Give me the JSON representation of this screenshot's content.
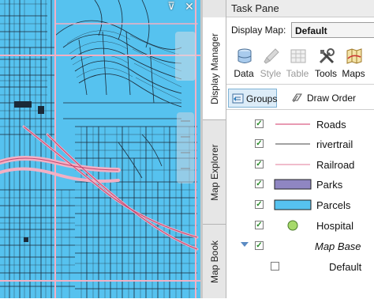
{
  "map_controls": {
    "pin_glyph": "⊽",
    "close_glyph": "✕"
  },
  "side_tabs": [
    "Display Manager",
    "Map Explorer",
    "Map Book"
  ],
  "task_pane": {
    "title": "Task Pane",
    "display_map_label": "Display Map:",
    "display_map_value": "Default",
    "tools": [
      {
        "label": "Data",
        "icon": "database-icon",
        "enabled": true
      },
      {
        "label": "Style",
        "icon": "brush-icon",
        "enabled": false
      },
      {
        "label": "Table",
        "icon": "table-icon",
        "enabled": false
      },
      {
        "label": "Tools",
        "icon": "tools-icon",
        "enabled": true
      },
      {
        "label": "Maps",
        "icon": "maps-icon",
        "enabled": true
      }
    ],
    "groups_label": "Groups",
    "draw_order_label": "Draw Order"
  },
  "layers": [
    {
      "name": "Roads",
      "checked": true,
      "style": "line",
      "color": "#e07a9a"
    },
    {
      "name": "rivertrail",
      "checked": true,
      "style": "line",
      "color": "#333333"
    },
    {
      "name": "Railroad",
      "checked": true,
      "style": "line",
      "color": "#e07a9a"
    },
    {
      "name": "Parks",
      "checked": true,
      "style": "fill",
      "color": "#8f86c2"
    },
    {
      "name": "Parcels",
      "checked": true,
      "style": "fill",
      "color": "#56c2ef"
    },
    {
      "name": "Hospital",
      "checked": true,
      "style": "point",
      "color": "#a6d96a"
    },
    {
      "name": "Map Base",
      "checked": true,
      "style": "group"
    },
    {
      "name": "Default",
      "checked": false,
      "style": "none"
    }
  ],
  "colors": {
    "parcels": "#56c2ef",
    "roads": "#f2a9bd",
    "lines": "#1b2a38"
  }
}
